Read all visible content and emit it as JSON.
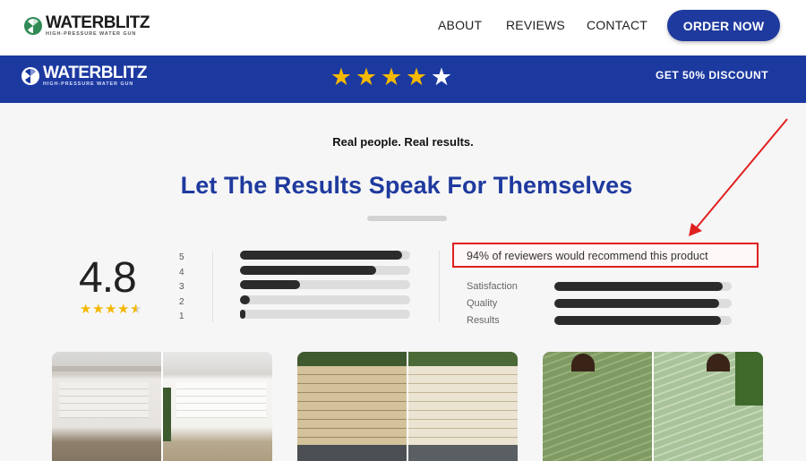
{
  "nav": {
    "logo": {
      "brand": "WATERBLITZ",
      "tagline": "HIGH-PRESSURE WATER GUN"
    },
    "links": [
      "ABOUT",
      "REVIEWS",
      "CONTACT"
    ],
    "cta": "ORDER NOW"
  },
  "banner": {
    "logo": {
      "brand": "WATERBLITZ",
      "tagline": "HIGH-PRESSURE WATER GUN"
    },
    "stars_filled": 4,
    "stars_total": 5,
    "discount": "GET 50% DISCOUNT"
  },
  "section": {
    "eyebrow": "Real people. Real results.",
    "headline": "Let The Results Speak For Themselves"
  },
  "rating": {
    "score": "4.8",
    "star_levels": [
      "5",
      "4",
      "3",
      "2",
      "1"
    ],
    "distribution": [
      0.95,
      0.8,
      0.35,
      0.06,
      0.03
    ],
    "recommend_text": "94% of reviewers would recommend this product",
    "metrics": [
      {
        "label": "Satisfaction",
        "value": 0.95
      },
      {
        "label": "Quality",
        "value": 0.93
      },
      {
        "label": "Results",
        "value": 0.94
      }
    ]
  },
  "colors": {
    "brand_blue": "#1c39a0",
    "star_yellow": "#f4b800",
    "highlight_red": "#e0201f"
  },
  "photos": [
    {
      "subject": "garage-before-after"
    },
    {
      "subject": "brick-wall-before-after"
    },
    {
      "subject": "siding-before-after"
    }
  ]
}
